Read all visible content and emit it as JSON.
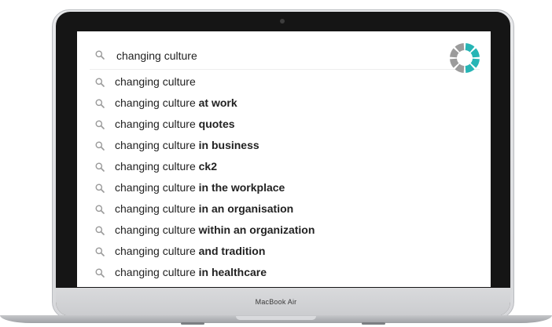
{
  "device": {
    "brand_label": "MacBook Air"
  },
  "search": {
    "query": "changing culture",
    "icon": "search-icon",
    "spinner": {
      "icon": "loading-spinner-icon",
      "colors": {
        "teal": "#26b5b5",
        "gray": "#9b9b9b"
      },
      "segments": 8,
      "teal_segments": 4
    }
  },
  "suggestions": [
    {
      "prefix": "changing culture",
      "completion": ""
    },
    {
      "prefix": "changing culture",
      "completion": "at work"
    },
    {
      "prefix": "changing culture",
      "completion": "quotes"
    },
    {
      "prefix": "changing culture",
      "completion": "in business"
    },
    {
      "prefix": "changing culture",
      "completion": "ck2"
    },
    {
      "prefix": "changing culture",
      "completion": "in the workplace"
    },
    {
      "prefix": "changing culture",
      "completion": "in an organisation"
    },
    {
      "prefix": "changing culture",
      "completion": "within an organization"
    },
    {
      "prefix": "changing culture",
      "completion": "and tradition"
    },
    {
      "prefix": "changing culture",
      "completion": "in healthcare"
    }
  ]
}
